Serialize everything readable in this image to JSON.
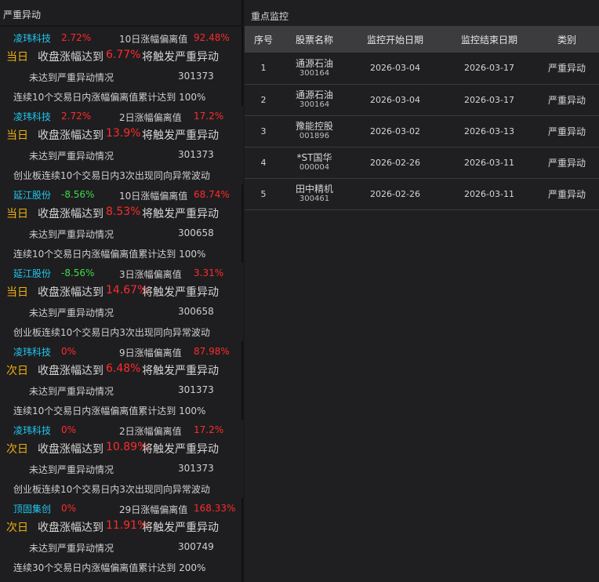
{
  "left_panel": {
    "title": "严重异动",
    "cards": [
      {
        "name": "凌玮科技",
        "pct": "2.72%",
        "pct_color": "#ff2b2b",
        "metric": "10日涨幅偏离值",
        "metric_value": "92.48%",
        "day": "当日",
        "pre": "收盘涨幅达到",
        "threshold": "6.77%",
        "post": "将触发严重异动",
        "status": "未达到严重异动情况",
        "code": "301373",
        "rule": "连续10个交易日内涨幅偏离值累计达到 100%"
      },
      {
        "name": "凌玮科技",
        "pct": "2.72%",
        "pct_color": "#ff2b2b",
        "metric": "2日涨幅偏离值",
        "metric_value": "17.2%",
        "day": "当日",
        "pre": "收盘涨幅达到",
        "threshold": "13.9%",
        "post": "将触发严重异动",
        "status": "未达到严重异动情况",
        "code": "301373",
        "rule": "创业板连续10个交易日内3次出现同向异常波动"
      },
      {
        "name": "延江股份",
        "pct": "-8.56%",
        "pct_color": "#3fd94a",
        "metric": "10日涨幅偏离值",
        "metric_value": "68.74%",
        "day": "当日",
        "pre": "收盘涨幅达到",
        "threshold": "8.53%",
        "post": "将触发严重异动",
        "status": "未达到严重异动情况",
        "code": "300658",
        "rule": "连续10个交易日内涨幅偏离值累计达到 100%"
      },
      {
        "name": "延江股份",
        "pct": "-8.56%",
        "pct_color": "#3fd94a",
        "metric": "3日涨幅偏离值",
        "metric_value": "3.31%",
        "day": "当日",
        "pre": "收盘涨幅达到",
        "threshold": "14.67%",
        "post": "将触发严重异动",
        "status": "未达到严重异动情况",
        "code": "300658",
        "rule": "创业板连续10个交易日内3次出现同向异常波动"
      },
      {
        "name": "凌玮科技",
        "pct": "0%",
        "pct_color": "#ff2b2b",
        "metric": "9日涨幅偏离值",
        "metric_value": "87.98%",
        "day": "次日",
        "pre": "收盘涨幅达到",
        "threshold": "6.48%",
        "post": "将触发严重异动",
        "status": "未达到严重异动情况",
        "code": "301373",
        "rule": "连续10个交易日内涨幅偏离值累计达到 100%"
      },
      {
        "name": "凌玮科技",
        "pct": "0%",
        "pct_color": "#ff2b2b",
        "metric": "2日涨幅偏离值",
        "metric_value": "17.2%",
        "day": "次日",
        "pre": "收盘涨幅达到",
        "threshold": "10.89%",
        "post": "将触发严重异动",
        "status": "未达到严重异动情况",
        "code": "301373",
        "rule": "创业板连续10个交易日内3次出现同向异常波动"
      },
      {
        "name": "顶固集创",
        "pct": "0%",
        "pct_color": "#ff2b2b",
        "metric": "29日涨幅偏离值",
        "metric_value": "168.33%",
        "day": "次日",
        "pre": "收盘涨幅达到",
        "threshold": "11.91%",
        "post": "将触发严重异动",
        "status": "未达到严重异动情况",
        "code": "300749",
        "rule": "连续30个交易日内涨幅偏离值累计达到 200%"
      }
    ]
  },
  "right_panel": {
    "title": "重点监控",
    "columns": [
      "序号",
      "股票名称",
      "监控开始日期",
      "监控结束日期",
      "类别"
    ],
    "rows": [
      {
        "idx": "1",
        "name": "通源石油",
        "code": "300164",
        "start": "2026-03-04",
        "end": "2026-03-17",
        "type": "严重异动"
      },
      {
        "idx": "2",
        "name": "通源石油",
        "code": "300164",
        "start": "2026-03-04",
        "end": "2026-03-17",
        "type": "严重异动"
      },
      {
        "idx": "3",
        "name": "豫能控股",
        "code": "001896",
        "start": "2026-03-02",
        "end": "2026-03-13",
        "type": "严重异动"
      },
      {
        "idx": "4",
        "name": "*ST国华",
        "code": "000004",
        "start": "2026-02-26",
        "end": "2026-03-11",
        "type": "严重异动"
      },
      {
        "idx": "5",
        "name": "田中精机",
        "code": "300461",
        "start": "2026-02-26",
        "end": "2026-03-11",
        "type": "严重异动"
      }
    ]
  }
}
